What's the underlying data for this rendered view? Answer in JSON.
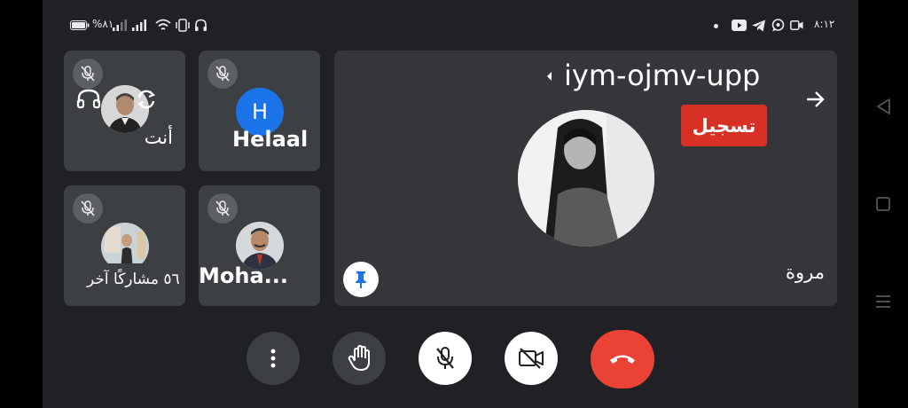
{
  "status_bar": {
    "battery": "%٨١",
    "time": "٨:١٢"
  },
  "meeting": {
    "code": "iym-ojmv-upp",
    "recording_label": "تسجيل"
  },
  "tiles": {
    "self": {
      "name": "أنت"
    },
    "helaal": {
      "name": "Helaal",
      "initial": "H"
    },
    "others": {
      "label": "٥٦ مشاركًا آخر"
    },
    "moha": {
      "name": "Moha..."
    },
    "main": {
      "name": "مروة"
    }
  },
  "colors": {
    "background": "#202124",
    "tile": "#3c4043",
    "end_call": "#ea4335",
    "recording": "#d93025",
    "helaal_avatar": "#1a73e8"
  }
}
